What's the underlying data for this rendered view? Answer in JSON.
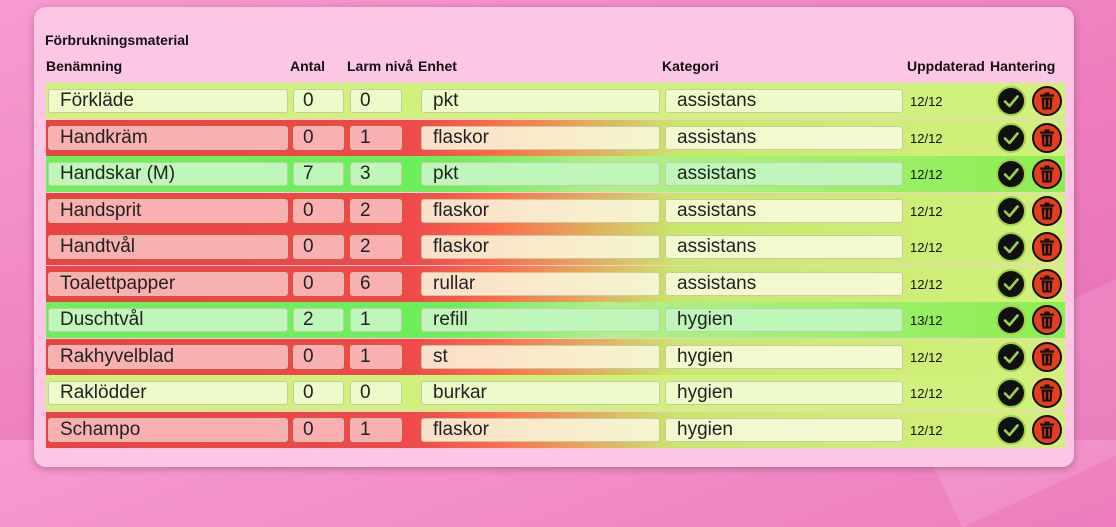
{
  "panel": {
    "title": "Förbrukningsmaterial"
  },
  "columns": {
    "name": "Benämning",
    "antal": "Antal",
    "larm": "Larm nivå",
    "unit": "Enhet",
    "category": "Kategori",
    "updated": "Uppdaterad",
    "actions": "Hantering"
  },
  "icons": {
    "confirm": "checkmark-icon",
    "delete": "trash-icon"
  },
  "colors": {
    "low_stock": "#e94444",
    "in_stock": "#6cf15d",
    "neutral": "#d1f17d",
    "confirm_button": "#101010",
    "delete_button": "#e83d1c"
  },
  "items": [
    {
      "name": "Förkläde",
      "antal": "0",
      "larm": "0",
      "unit": "pkt",
      "category": "assistans",
      "updated": "12/12",
      "status": "normal"
    },
    {
      "name": "Handkräm",
      "antal": "0",
      "larm": "1",
      "unit": "flaskor",
      "category": "assistans",
      "updated": "12/12",
      "status": "low"
    },
    {
      "name": "Handskar (M)",
      "antal": "7",
      "larm": "3",
      "unit": "pkt",
      "category": "assistans",
      "updated": "12/12",
      "status": "ok"
    },
    {
      "name": "Handsprit",
      "antal": "0",
      "larm": "2",
      "unit": "flaskor",
      "category": "assistans",
      "updated": "12/12",
      "status": "low"
    },
    {
      "name": "Handtvål",
      "antal": "0",
      "larm": "2",
      "unit": "flaskor",
      "category": "assistans",
      "updated": "12/12",
      "status": "low"
    },
    {
      "name": "Toalettpapper",
      "antal": "0",
      "larm": "6",
      "unit": "rullar",
      "category": "assistans",
      "updated": "12/12",
      "status": "low"
    },
    {
      "name": "Duschtvål",
      "antal": "2",
      "larm": "1",
      "unit": "refill",
      "category": "hygien",
      "updated": "13/12",
      "status": "ok"
    },
    {
      "name": "Rakhyvelblad",
      "antal": "0",
      "larm": "1",
      "unit": "st",
      "category": "hygien",
      "updated": "12/12",
      "status": "low"
    },
    {
      "name": "Raklödder",
      "antal": "0",
      "larm": "0",
      "unit": "burkar",
      "category": "hygien",
      "updated": "12/12",
      "status": "normal"
    },
    {
      "name": "Schampo",
      "antal": "0",
      "larm": "1",
      "unit": "flaskor",
      "category": "hygien",
      "updated": "12/12",
      "status": "low"
    }
  ]
}
